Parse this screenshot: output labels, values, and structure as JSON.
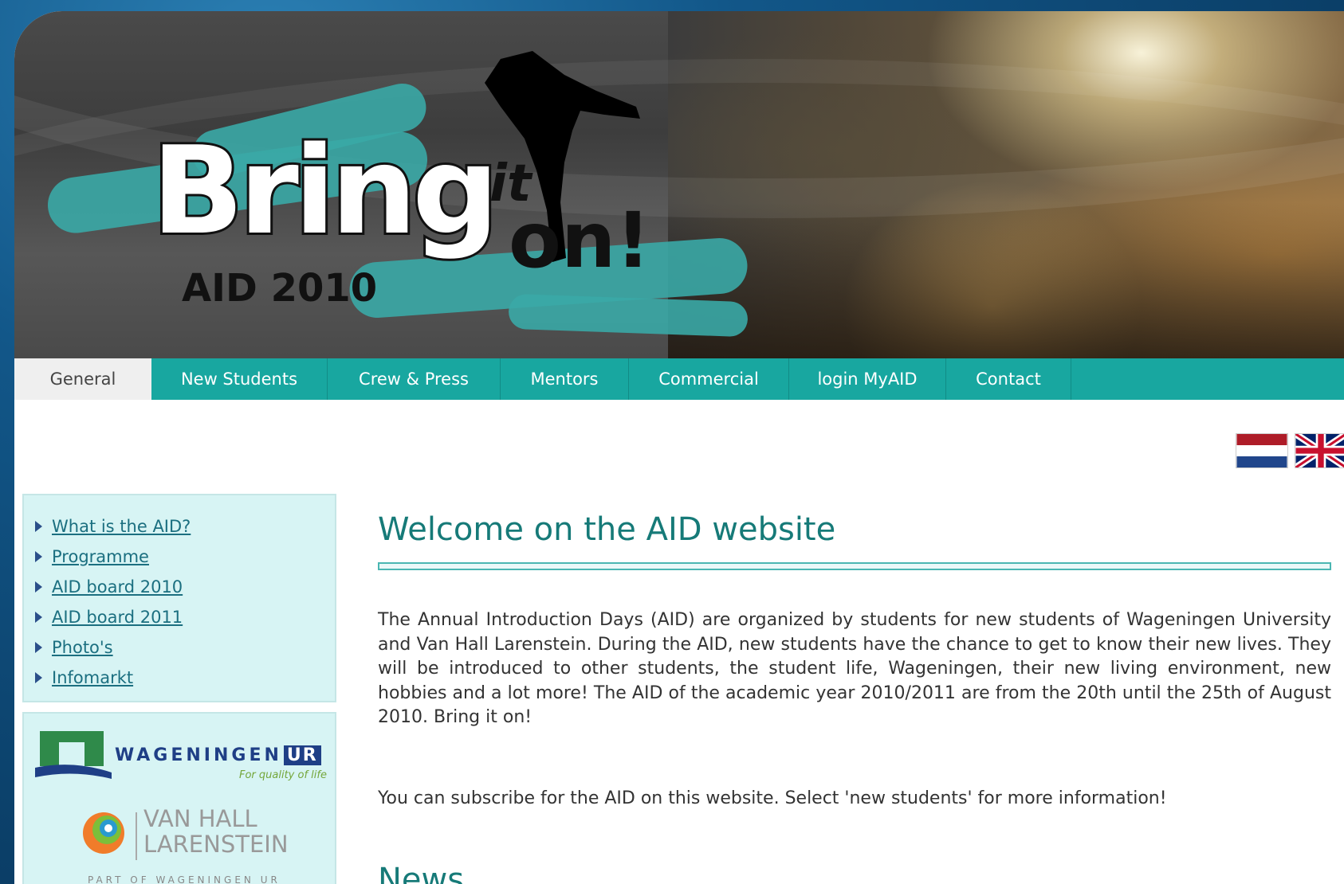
{
  "header": {
    "logo": {
      "word1": "Bring",
      "word2": "it",
      "word3": "on!",
      "subtitle": "AID 2010"
    }
  },
  "nav": {
    "items": [
      {
        "label": "General",
        "active": true
      },
      {
        "label": "New Students",
        "active": false
      },
      {
        "label": "Crew & Press",
        "active": false
      },
      {
        "label": "Mentors",
        "active": false
      },
      {
        "label": "Commercial",
        "active": false
      },
      {
        "label": "login MyAID",
        "active": false
      },
      {
        "label": "Contact",
        "active": false
      }
    ]
  },
  "language_flags": [
    "dutch-flag-icon",
    "uk-flag-icon"
  ],
  "sidebar": {
    "links": [
      {
        "label": "What is the AID?"
      },
      {
        "label": "Programme"
      },
      {
        "label": "AID board 2010"
      },
      {
        "label": "AID board 2011"
      },
      {
        "label": "Photo's"
      },
      {
        "label": "Infomarkt"
      }
    ],
    "logos": {
      "wur_name": "WAGENINGEN",
      "wur_ur": "UR",
      "wur_tagline": "For quality of life",
      "vhl_line1": "VAN HALL",
      "vhl_line2": "LARENSTEIN",
      "vhl_part": "PART OF WAGENINGEN UR"
    }
  },
  "main": {
    "welcome_title": "Welcome on the AID website",
    "intro": "The Annual Introduction Days (AID) are organized by students for new students of Wageningen University and Van Hall Larenstein. During the AID, new students have the chance to get to know their new lives. They will be introduced to other students, the student life, Wageningen, their new living environment, new hobbies and a lot more! The AID of the academic year 2010/2011 are from the 20th until the 25th of August 2010. Bring it on!",
    "subscribe": "You can subscribe for the AID on this website. Select 'new students' for more information!",
    "news_title": "News"
  },
  "colors": {
    "nav_teal": "#18a7a0",
    "heading_teal": "#167a78",
    "sidebar_bg": "#d7f4f4",
    "frame_blue": "#0f4a78"
  }
}
